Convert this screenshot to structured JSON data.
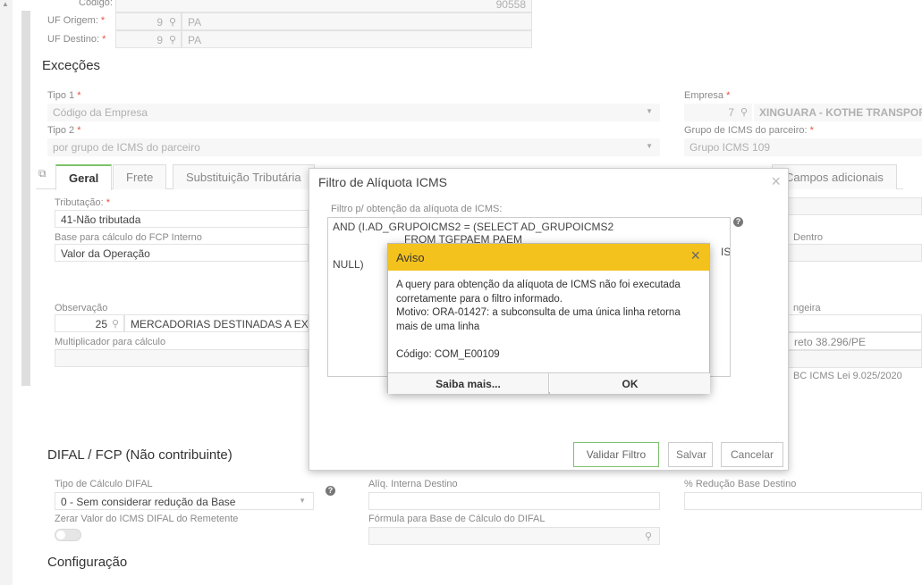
{
  "header_fields": {
    "codigo_label": "Código:",
    "codigo_value": "90558",
    "uf_origem_label": "UF Origem:",
    "uf_origem_code": "9",
    "uf_origem_value": "PA",
    "uf_destino_label": "UF Destino:",
    "uf_destino_code": "9",
    "uf_destino_value": "PA",
    "required_mark": "*"
  },
  "excecoes": {
    "title": "Exceções",
    "tipo1_label": "Tipo 1",
    "tipo1_value": "Código da Empresa",
    "tipo2_label": "Tipo 2",
    "tipo2_value": "por grupo de ICMS do parceiro",
    "empresa_label": "Empresa",
    "empresa_code": "7",
    "empresa_value": "XINGUARA - KOTHE TRANSPOR",
    "grupo_label": "Grupo de ICMS do parceiro:",
    "grupo_value": "Grupo ICMS 109"
  },
  "tabs": {
    "geral": "Geral",
    "frete": "Frete",
    "substituicao": "Substituição Tributária",
    "campos": "Campos adicionais"
  },
  "geral": {
    "tributacao_label": "Tributação:",
    "tributacao_value": "41-Não tributada",
    "base_fcp_label": "Base para cálculo do FCP Interno",
    "base_fcp_value": "Valor da Operação",
    "observacao_label": "Observação",
    "observacao_code": "25",
    "observacao_value": "MERCADORIAS DESTINADAS A EX",
    "multiplicador_label": "Multiplicador para cálculo",
    "right_dentro": "Dentro",
    "right_ngeira": "ngeira",
    "right_reto": "reto 38.296/PE",
    "right_bc": "BC ICMS Lei 9.025/2020"
  },
  "difal": {
    "title": "DIFAL / FCP (Não contribuinte)",
    "tipo_calc_label": "Tipo de Cálculo DIFAL",
    "tipo_calc_value": "0 - Sem considerar redução da Base",
    "aliq_label": "Alíq. Interna Destino",
    "reducao_label": "% Redução Base Destino",
    "zerar_label": "Zerar Valor do ICMS DIFAL do Remetente",
    "formula_label": "Fórmula para Base de Cálculo do DIFAL"
  },
  "configuracao": {
    "title": "Configuração"
  },
  "modal": {
    "title": "Filtro de Alíquota ICMS",
    "field_label": "Filtro p/ obtenção da alíquota de ICMS:",
    "line1": "AND (I.AD_GRUPOICMS2 = (SELECT AD_GRUPOICMS2",
    "line2": "FROM TGFPAEM PAEM",
    "line3_tail": "IS",
    "line4": "NULL)",
    "validar": "Validar Filtro",
    "salvar": "Salvar",
    "cancelar": "Cancelar"
  },
  "alert": {
    "title": "Aviso",
    "line1": "A query para obtenção da alíquota de ICMS não foi executada",
    "line2": "corretamente para o filtro informado.",
    "line3": "Motivo: ORA-01427: a subconsulta de uma única linha retorna",
    "line4": "mais de uma linha",
    "codigo": "Código: COM_E00109",
    "saiba": "Saiba mais...",
    "ok": "OK"
  },
  "colors": {
    "accent_green": "#7cc36a",
    "warning_yellow": "#f4c21c",
    "required_red": "#e5533d"
  }
}
